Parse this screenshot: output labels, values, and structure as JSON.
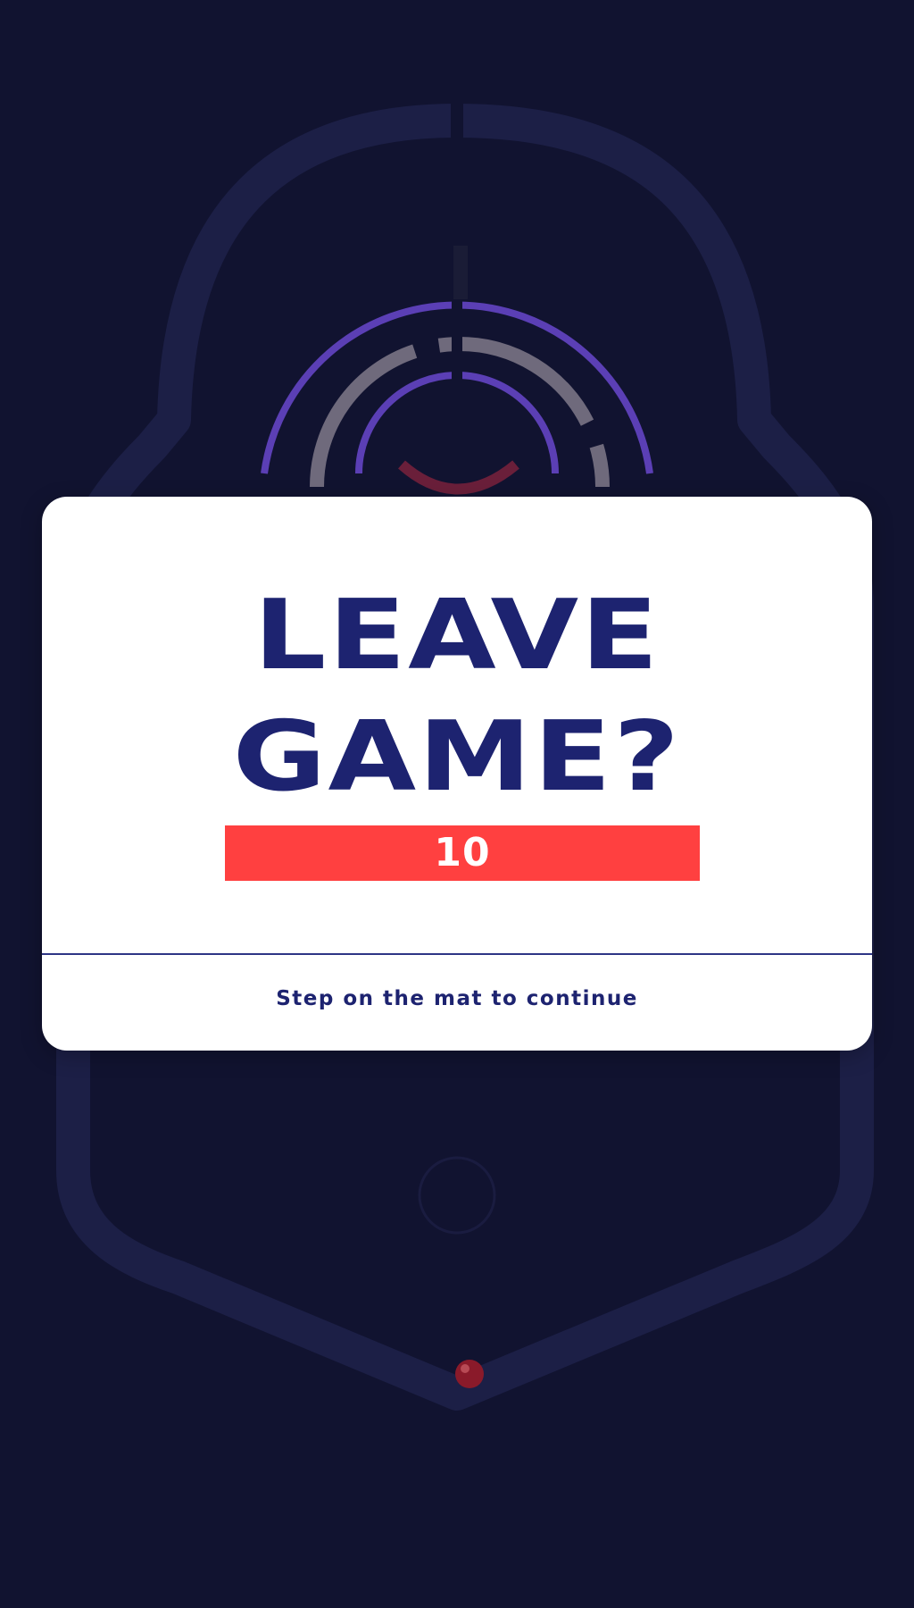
{
  "modal": {
    "title_line1": "LEAVE",
    "title_line2": "GAME?",
    "countdown": "10",
    "hint": "Step on the mat to continue"
  },
  "icons": {
    "board": "maze-board-background",
    "ball": "ball-icon"
  },
  "colors": {
    "background": "#111330",
    "modal": "#ffffff",
    "title": "#1d2370",
    "countdown_bg": "#ff4040",
    "countdown_text": "#ffffff",
    "ring": "#5b3fb5",
    "ball": "#8a1a2a"
  }
}
